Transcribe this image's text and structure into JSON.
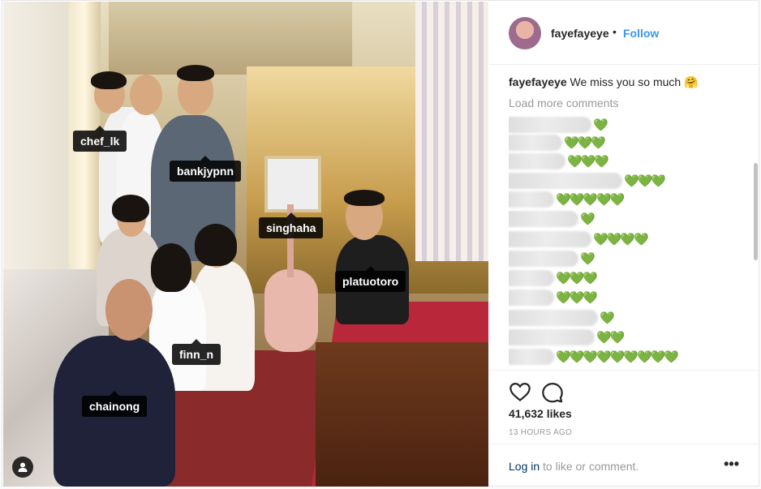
{
  "post": {
    "username": "fayefayeye",
    "separator": "•",
    "follow_label": "Follow",
    "caption_user": "fayefayeye",
    "caption_text": "We miss you so much 🤗",
    "load_more_label": "Load more comments",
    "likes_label": "41,632 likes",
    "timestamp": "13 HOURS AGO",
    "login_link": "Log in",
    "login_suffix": " to like or comment.",
    "more_label": "•••"
  },
  "photo_tags": [
    "chef_lk",
    "bankjypnn",
    "singhaha",
    "platuotoro",
    "finn_n",
    "chainong"
  ],
  "comments": [
    {
      "hearts": "💚"
    },
    {
      "hearts": "💚💚💚"
    },
    {
      "hearts": "💚💚💚"
    },
    {
      "hearts": "💚💚💚"
    },
    {
      "hearts": "💚💚💚💚💚"
    },
    {
      "hearts": "💚"
    },
    {
      "hearts": "💚💚💚💚"
    },
    {
      "hearts": "💚"
    },
    {
      "hearts": "💚💚💚"
    },
    {
      "hearts": "💚💚💚"
    },
    {
      "hearts": "💚"
    },
    {
      "hearts": "💚💚"
    },
    {
      "hearts": "💚💚💚💚💚💚💚💚💚"
    }
  ],
  "icons": {
    "like": "heart-outline-icon",
    "comment": "speech-bubble-icon",
    "user_tag": "person-icon"
  },
  "colors": {
    "follow_blue": "#3897f0",
    "login_link": "#003569",
    "muted": "#999999",
    "heart_green": "#55c83b"
  }
}
